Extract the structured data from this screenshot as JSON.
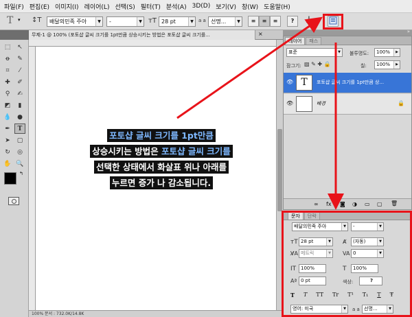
{
  "menubar": [
    "파일(F)",
    "편집(E)",
    "이미지(I)",
    "레이어(L)",
    "선택(S)",
    "필터(T)",
    "분석(A)",
    "3D(D)",
    "보기(V)",
    "창(W)",
    "도움말(H)"
  ],
  "options_bar": {
    "tool_glyph": "T",
    "font_family": "배달의민족 주아",
    "font_style": "-",
    "font_size": "28 pt",
    "aa_label": "a a",
    "antialias": "선명...",
    "align_left": "≡",
    "align_center": "≡",
    "align_right": "≡",
    "help_glyph": "?"
  },
  "document": {
    "tab_title": "무제-1 @ 100% (포토샵 글씨 크기를 1pt만큼 상승시키는 방법은 포토샵 글씨 크기를...",
    "status": "100%   문서 : 732.0K/14.8K"
  },
  "caption": [
    {
      "text": "포토샵 글씨 크기를 1pt만큼",
      "highlight": true
    },
    {
      "text": "상승시키는 방법은",
      "highlight": false,
      "tail": " 포토샵 글씨 크기를"
    },
    {
      "text": "선택한 상태에서 화살표 위나 아래를",
      "highlight": false
    },
    {
      "text": "누르면 증가 나 감소됩니다.",
      "highlight": false
    }
  ],
  "layers_panel": {
    "tabs": [
      "레이어",
      "패스"
    ],
    "blend_mode": "표준",
    "opacity_label": "불투명도:",
    "opacity": "100%",
    "lock_label": "잠그기:",
    "fill_label": "칠:",
    "fill": "100%",
    "layers": [
      {
        "name": "포토샵 글씨 크기를 1pt만큼 상...",
        "type": "text",
        "thumb": "T",
        "selected": true
      },
      {
        "name": "배경",
        "type": "background",
        "thumb": "",
        "selected": false
      }
    ],
    "footer_icons": [
      "∞",
      "fx",
      "◙",
      "◑",
      "▭",
      "▢",
      "🗑"
    ]
  },
  "character_panel": {
    "tabs": [
      "문자",
      "단락"
    ],
    "font_family": "배달의민족 주아",
    "font_style": "-",
    "size": "28 pt",
    "leading": "(자동)",
    "kerning": "메트릭",
    "tracking": "0",
    "vscale": "100%",
    "hscale": "100%",
    "baseline": "0 pt",
    "color_label": "색상:",
    "color_value": "?",
    "style_buttons": [
      "T",
      "T",
      "TT",
      "Tr",
      "T¹",
      "T₁",
      "T",
      "Ŧ"
    ],
    "language": "영어: 미국",
    "aa_label": "a a",
    "antialias": "선명..."
  },
  "colors": {
    "annotation_red": "#e8131a",
    "selection_blue": "#3875d7",
    "highlight_text": "#7eb8ff"
  }
}
